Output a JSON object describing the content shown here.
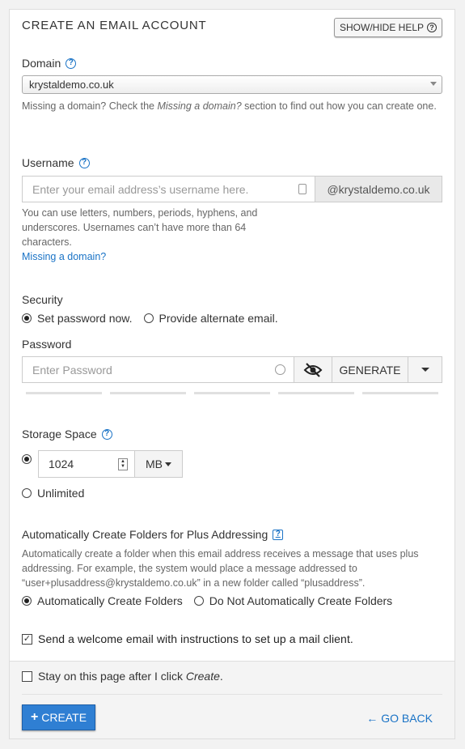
{
  "header": {
    "title": "CREATE AN EMAIL ACCOUNT",
    "help_button": "SHOW/HIDE HELP"
  },
  "domain": {
    "label": "Domain",
    "selected": "krystaldemo.co.uk",
    "hint_prefix": "Missing a domain? Check the ",
    "hint_italic": "Missing a domain?",
    "hint_suffix": " section to find out how you can create one."
  },
  "username": {
    "label": "Username",
    "placeholder": "Enter your email address’s username here.",
    "domain_suffix": "@krystaldemo.co.uk",
    "hint": "You can use letters, numbers, periods, hyphens, and underscores. Usernames can’t have more than 64 characters.",
    "missing_link": "Missing a domain?"
  },
  "security": {
    "label": "Security",
    "option_set": "Set password now.",
    "option_alt": "Provide alternate email.",
    "password_label": "Password",
    "password_placeholder": "Enter Password",
    "generate": "GENERATE"
  },
  "storage": {
    "label": "Storage Space",
    "value": "1024",
    "unit": "MB",
    "unlimited": "Unlimited"
  },
  "plus": {
    "label": "Automatically Create Folders for Plus Addressing",
    "hint": "Automatically create a folder when this email address receives a message that uses plus addressing. For example, the system would place a message addressed to “user+plusaddress@krystaldemo.co.uk” in a new folder called “plusaddress”.",
    "option_auto": "Automatically Create Folders",
    "option_none": "Do Not Automatically Create Folders"
  },
  "welcome": {
    "label": "Send a welcome email with instructions to set up a mail client."
  },
  "footer": {
    "stay_prefix": "Stay on this page after I click ",
    "stay_italic": "Create",
    "stay_suffix": ".",
    "create": "CREATE",
    "go_back": "GO BACK"
  },
  "colors": {
    "accent": "#2f7fd3",
    "link": "#1a73c6"
  }
}
